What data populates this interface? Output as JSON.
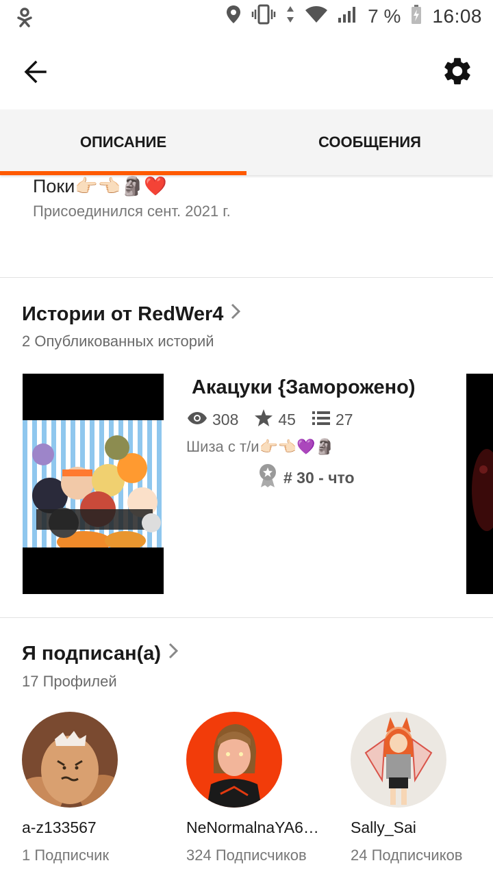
{
  "status_bar": {
    "battery": "7 %",
    "time": "16:08",
    "icons": [
      "ok-logo-icon",
      "location-icon",
      "vibrate-icon",
      "data-arrows-icon",
      "wifi-icon",
      "signal-icon",
      "battery-icon"
    ]
  },
  "app_bar": {
    "icons": [
      "back-arrow-icon",
      "gear-icon"
    ]
  },
  "tabs": [
    {
      "label": "ОПИСАНИЕ",
      "active": true
    },
    {
      "label": "СООБЩЕНИЯ",
      "active": false
    }
  ],
  "profile": {
    "description": "Поки👉🏻👈🏻🗿❤️",
    "joined": "Присоединился сент. 2021 г."
  },
  "stories": {
    "title": "Истории от RedWer4",
    "subtitle": "2 Опубликованных историй",
    "items": [
      {
        "title": "Акацуки {Заморожено)",
        "views": "308",
        "votes": "45",
        "parts": "27",
        "description": "Шиза с т/и👉🏻👈🏻💜🗿",
        "rank": "# 30 - что"
      }
    ]
  },
  "following": {
    "title": "Я подписан(а)",
    "subtitle": "17 Профилей",
    "profiles": [
      {
        "name": "a-z133567",
        "followers": "1 Подписчик"
      },
      {
        "name": "NeNormalnaYA6…",
        "followers": "324 Подписчиков"
      },
      {
        "name": "Sally_Sai",
        "followers": "24 Подписчиков"
      }
    ]
  },
  "colors": {
    "accent": "#ff5a00",
    "tab_bg": "#f4f4f4",
    "muted_text": "#777777"
  }
}
